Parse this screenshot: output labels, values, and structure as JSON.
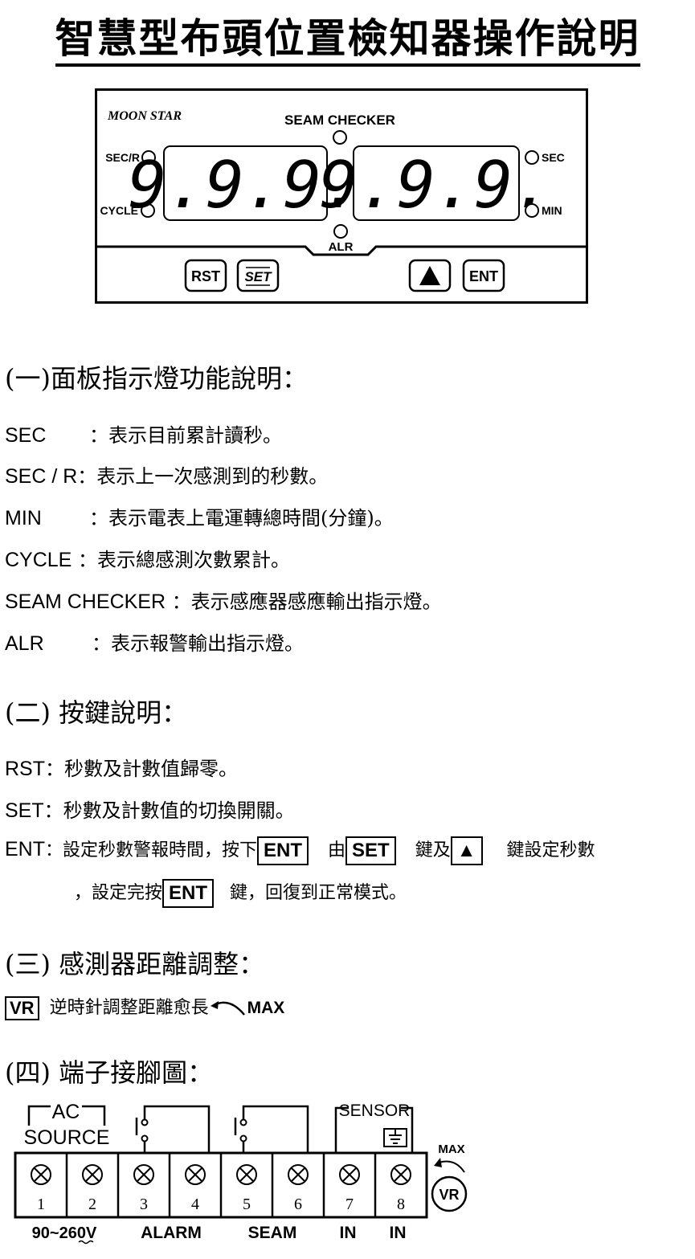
{
  "title": "智慧型布頭位置檢知器操作說明",
  "panel": {
    "brand": "MOON STAR",
    "seam_checker": "SEAM CHECKER",
    "left_top_indicator": "SEC/R",
    "left_bottom_indicator": "CYCLE",
    "right_top_indicator": "SEC",
    "right_bottom_indicator": "MIN",
    "alr": "ALR",
    "left_display": "9.9.9.",
    "right_display": "9.9.9.",
    "buttons": {
      "rst": "RST",
      "set": "SET",
      "up": "▲",
      "ent": "ENT"
    }
  },
  "section1": {
    "heading": "(一)面板指示燈功能說明：",
    "items": [
      {
        "key": "SEC",
        "text": "：表示目前累計讀秒。"
      },
      {
        "key": "SEC / R",
        "text": "：表示上一次感測到的秒數。"
      },
      {
        "key": "MIN",
        "text": "：表示電表上電運轉總時間(分鐘)。"
      },
      {
        "key": "CYCLE",
        "text": "：表示總感測次數累計。"
      },
      {
        "key": "SEAM CHECKER",
        "text": "：表示感應器感應輸出指示燈。"
      },
      {
        "key": "ALR",
        "text": "：表示報警輸出指示燈。"
      }
    ]
  },
  "section2": {
    "heading": "(二) 按鍵說明：",
    "rst": {
      "key": "RST",
      "text": "：秒數及計數值歸零。"
    },
    "set": {
      "key": "SET",
      "text": "：秒數及計數值的切換開關。"
    },
    "ent": {
      "key": "ENT",
      "t1": "：設定秒數警報時間，按下",
      "k1": "ENT",
      "t2": "由",
      "k2": "SET",
      "t3": "鍵及",
      "k3": "▲",
      "t4": "鍵設定秒數",
      "t5": "，設定完按",
      "k4": "ENT",
      "t6": "鍵，回復到正常模式。"
    }
  },
  "section3": {
    "heading": "(三) 感測器距離調整：",
    "vr": "VR",
    "text": "逆時針調整距離愈長",
    "max": "MAX"
  },
  "section4": {
    "heading": "(四) 端子接腳圖：",
    "ac": "AC",
    "source": "SOURCE",
    "sensor": "SENSOR",
    "max": "MAX",
    "vr": "VR",
    "terminals": [
      "1",
      "2",
      "3",
      "4",
      "5",
      "6",
      "7",
      "8"
    ],
    "bottom_labels": {
      "voltage": "90~260V",
      "alarm": "ALARM",
      "seam": "SEAM",
      "in1": "IN",
      "in2": "IN"
    }
  }
}
